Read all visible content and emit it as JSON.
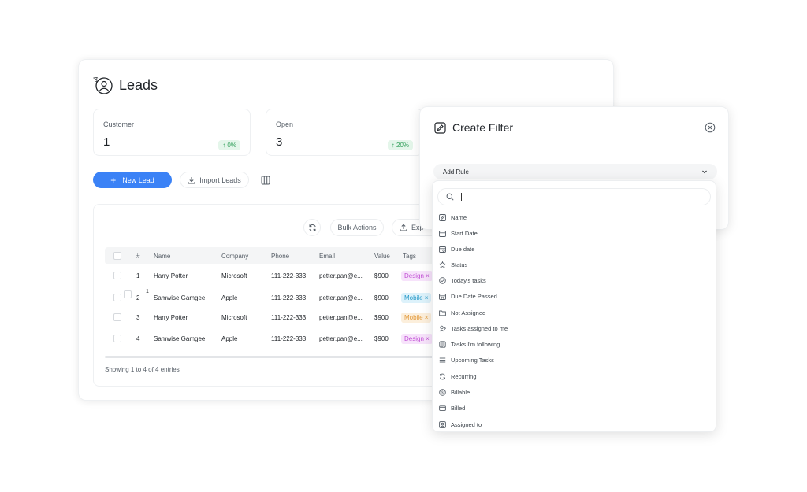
{
  "leads": {
    "title": "Leads",
    "stats": [
      {
        "label": "Customer",
        "value": "1",
        "change": "↑ 0%"
      },
      {
        "label": "Open",
        "value": "3",
        "change": "↑ 20%"
      }
    ],
    "new_lead_label": "New Lead",
    "import_label": "Import Leads",
    "bulk_actions_label": "Bulk Actions",
    "export_label": "Exp",
    "columns": [
      "#",
      "Name",
      "Company",
      "Phone",
      "Email",
      "Value",
      "Tags"
    ],
    "rows": [
      {
        "num": "1",
        "name": "Harry Potter",
        "company": "Microsoft",
        "phone": "111-222-333",
        "email": "petter.pan@e...",
        "value": "$900",
        "tag": "Design ×"
      },
      {
        "num": "2",
        "name": "Samwise Gamgee",
        "company": "Apple",
        "phone": "111-222-333",
        "email": "petter.pan@e...",
        "value": "$900",
        "tag": "Mobile ×"
      },
      {
        "num": "3",
        "name": "Harry Potter",
        "company": "Microsoft",
        "phone": "111-222-333",
        "email": "petter.pan@e...",
        "value": "$900",
        "tag": "Mobile ×"
      },
      {
        "num": "4",
        "name": "Samwise Gamgee",
        "company": "Apple",
        "phone": "111-222-333",
        "email": "petter.pan@e...",
        "value": "$900",
        "tag": "Design ×"
      }
    ],
    "row2_badge": "1",
    "showing": "Showing 1 to 4 of 4 entries"
  },
  "filter": {
    "title": "Create Filter",
    "add_rule": "Add Rule",
    "search_value": "",
    "items": [
      {
        "label": "Name",
        "icon": "name-icon"
      },
      {
        "label": "Start Date",
        "icon": "calendar-icon"
      },
      {
        "label": "Due date",
        "icon": "calendar-due-icon"
      },
      {
        "label": "Status",
        "icon": "star-icon"
      },
      {
        "label": "Today's tasks",
        "icon": "today-icon"
      },
      {
        "label": "Due Date Passed",
        "icon": "calendar-passed-icon"
      },
      {
        "label": "Not Assigned",
        "icon": "folder-icon"
      },
      {
        "label": "Tasks assigned to me",
        "icon": "user-tag-icon"
      },
      {
        "label": "Tasks I'm following",
        "icon": "following-icon"
      },
      {
        "label": "Upcoming Tasks",
        "icon": "list-icon"
      },
      {
        "label": "Recurring",
        "icon": "recurring-icon"
      },
      {
        "label": "Billable",
        "icon": "dollar-icon"
      },
      {
        "label": "Billed",
        "icon": "billed-icon"
      },
      {
        "label": "Assigned to",
        "icon": "assigned-icon"
      }
    ]
  },
  "colors": {
    "accent": "#3b82f6",
    "success": "#2f9e58",
    "design_tag": "#c14fd4",
    "mobile_tag": "#2a9bc9",
    "export_tag": "#e39a3b"
  }
}
